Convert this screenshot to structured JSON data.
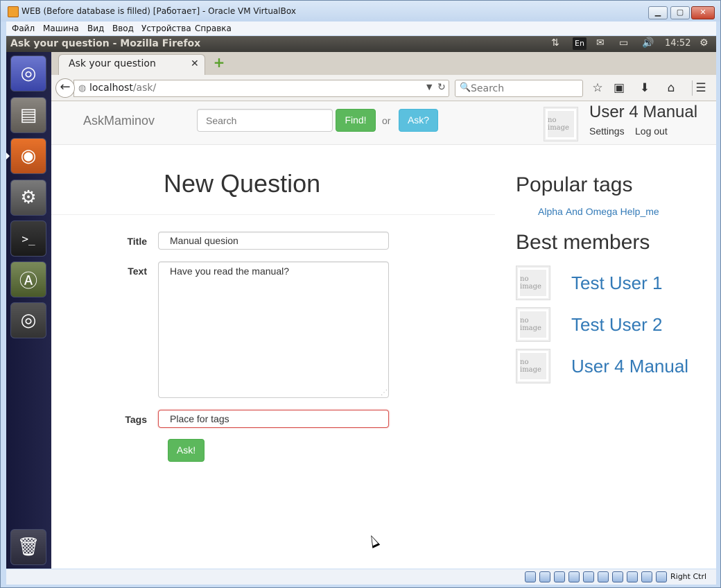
{
  "vbox": {
    "title": "WEB (Before database is filled) [Работает] - Oracle VM VirtualBox",
    "menu": [
      "Файл",
      "Машина",
      "Вид",
      "Ввод",
      "Устройства",
      "Справка"
    ],
    "host_key": "Right Ctrl"
  },
  "ubuntu": {
    "window_title": "Ask your question - Mozilla Firefox",
    "keyboard_layout": "En",
    "clock": "14:52"
  },
  "firefox": {
    "tab_title": "Ask your question",
    "url_host": "localhost",
    "url_path": "/ask/",
    "search_placeholder": "Search"
  },
  "site": {
    "brand": "AskMaminov",
    "search_placeholder": "Search",
    "find_label": "Find!",
    "or_label": "or",
    "ask_label": "Ask?",
    "user_name": "User 4 Manual",
    "settings_label": "Settings",
    "logout_label": "Log out",
    "avatar_text": "no image"
  },
  "form": {
    "heading": "New Question",
    "title_label": "Title",
    "title_value": "Manual quesion",
    "text_label": "Text",
    "text_value": "Have you read the manual?",
    "tags_label": "Tags",
    "tags_placeholder": "Place for tags",
    "submit_label": "Ask!"
  },
  "sidebar": {
    "popular_heading": "Popular tags",
    "tags": [
      "Alpha",
      "And",
      "Omega",
      "Help_me"
    ],
    "best_heading": "Best members",
    "members": [
      "Test User 1",
      "Test User 2",
      "User 4 Manual"
    ]
  }
}
